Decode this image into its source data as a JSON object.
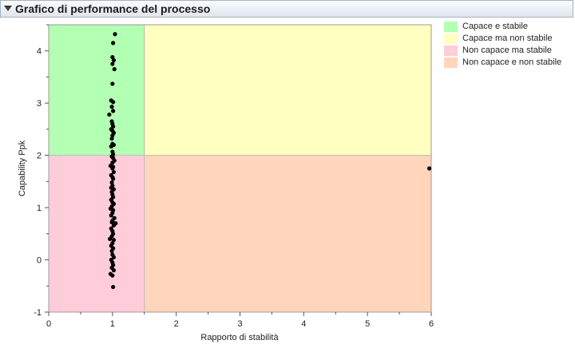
{
  "header": {
    "title": "Grafico di performance del processo"
  },
  "legend": {
    "items": [
      {
        "label": "Capace e stabile",
        "color": "#b3ffb3"
      },
      {
        "label": "Capace ma non stabile",
        "color": "#ffffc0"
      },
      {
        "label": "Non capace ma stabile",
        "color": "#ffccd9"
      },
      {
        "label": "Non capace e non stabile",
        "color": "#ffd5bb"
      }
    ]
  },
  "chart_data": {
    "type": "scatter",
    "title": "",
    "xlabel": "Rapporto di stabilità",
    "ylabel": "Capability Ppk",
    "xlim": [
      0,
      6
    ],
    "ylim": [
      -1,
      4.5
    ],
    "xticks": [
      0,
      1,
      2,
      3,
      4,
      5,
      6
    ],
    "yticks": [
      -1,
      0,
      1,
      2,
      3,
      4
    ],
    "regions": {
      "x_threshold": 1.5,
      "y_threshold": 2,
      "capable_stable": "#b3ffb3",
      "capable_unstable": "#ffffc0",
      "incapable_stable": "#ffccd9",
      "incapable_unstable": "#ffd5bb"
    },
    "point_color": "#000000",
    "points": [
      {
        "x": 1.04,
        "y": 4.32
      },
      {
        "x": 1.01,
        "y": 4.15
      },
      {
        "x": 1.0,
        "y": 3.88
      },
      {
        "x": 1.02,
        "y": 3.82
      },
      {
        "x": 1.0,
        "y": 3.75
      },
      {
        "x": 1.03,
        "y": 3.65
      },
      {
        "x": 1.0,
        "y": 3.37
      },
      {
        "x": 0.98,
        "y": 3.05
      },
      {
        "x": 1.01,
        "y": 3.02
      },
      {
        "x": 0.99,
        "y": 2.93
      },
      {
        "x": 1.01,
        "y": 2.85
      },
      {
        "x": 0.95,
        "y": 2.78
      },
      {
        "x": 0.99,
        "y": 2.65
      },
      {
        "x": 1.0,
        "y": 2.6
      },
      {
        "x": 1.01,
        "y": 2.55
      },
      {
        "x": 0.98,
        "y": 2.5
      },
      {
        "x": 1.0,
        "y": 2.47
      },
      {
        "x": 1.02,
        "y": 2.43
      },
      {
        "x": 1.0,
        "y": 2.38
      },
      {
        "x": 0.99,
        "y": 2.32
      },
      {
        "x": 1.0,
        "y": 2.22
      },
      {
        "x": 1.02,
        "y": 2.2
      },
      {
        "x": 0.98,
        "y": 2.17
      },
      {
        "x": 1.0,
        "y": 2.07
      },
      {
        "x": 1.01,
        "y": 2.02
      },
      {
        "x": 0.99,
        "y": 1.98
      },
      {
        "x": 1.01,
        "y": 1.95
      },
      {
        "x": 1.03,
        "y": 1.9
      },
      {
        "x": 1.0,
        "y": 1.86
      },
      {
        "x": 0.97,
        "y": 1.8
      },
      {
        "x": 1.01,
        "y": 1.78
      },
      {
        "x": 1.0,
        "y": 1.75
      },
      {
        "x": 1.02,
        "y": 1.68
      },
      {
        "x": 0.98,
        "y": 1.62
      },
      {
        "x": 1.0,
        "y": 1.58
      },
      {
        "x": 1.01,
        "y": 1.55
      },
      {
        "x": 0.99,
        "y": 1.48
      },
      {
        "x": 1.0,
        "y": 1.42
      },
      {
        "x": 0.98,
        "y": 1.38
      },
      {
        "x": 1.02,
        "y": 1.35
      },
      {
        "x": 0.99,
        "y": 1.3
      },
      {
        "x": 1.0,
        "y": 1.25
      },
      {
        "x": 1.01,
        "y": 1.2
      },
      {
        "x": 0.98,
        "y": 1.15
      },
      {
        "x": 1.0,
        "y": 1.1
      },
      {
        "x": 1.02,
        "y": 1.07
      },
      {
        "x": 0.99,
        "y": 1.02
      },
      {
        "x": 0.97,
        "y": 0.98
      },
      {
        "x": 1.01,
        "y": 0.95
      },
      {
        "x": 1.0,
        "y": 0.9
      },
      {
        "x": 0.98,
        "y": 0.85
      },
      {
        "x": 1.03,
        "y": 0.8
      },
      {
        "x": 1.0,
        "y": 0.75
      },
      {
        "x": 0.99,
        "y": 0.72
      },
      {
        "x": 1.05,
        "y": 0.7
      },
      {
        "x": 1.02,
        "y": 0.66
      },
      {
        "x": 0.98,
        "y": 0.6
      },
      {
        "x": 1.0,
        "y": 0.55
      },
      {
        "x": 1.01,
        "y": 0.5
      },
      {
        "x": 0.99,
        "y": 0.45
      },
      {
        "x": 0.96,
        "y": 0.4
      },
      {
        "x": 1.02,
        "y": 0.38
      },
      {
        "x": 1.0,
        "y": 0.32
      },
      {
        "x": 0.98,
        "y": 0.27
      },
      {
        "x": 1.01,
        "y": 0.22
      },
      {
        "x": 0.99,
        "y": 0.17
      },
      {
        "x": 1.0,
        "y": 0.1
      },
      {
        "x": 1.02,
        "y": 0.05
      },
      {
        "x": 0.98,
        "y": 0.0
      },
      {
        "x": 1.0,
        "y": -0.05
      },
      {
        "x": 1.01,
        "y": -0.1
      },
      {
        "x": 0.99,
        "y": -0.15
      },
      {
        "x": 1.02,
        "y": -0.2
      },
      {
        "x": 0.97,
        "y": -0.27
      },
      {
        "x": 1.0,
        "y": -0.3
      },
      {
        "x": 1.01,
        "y": -0.52
      },
      {
        "x": 5.97,
        "y": 1.75
      }
    ]
  }
}
